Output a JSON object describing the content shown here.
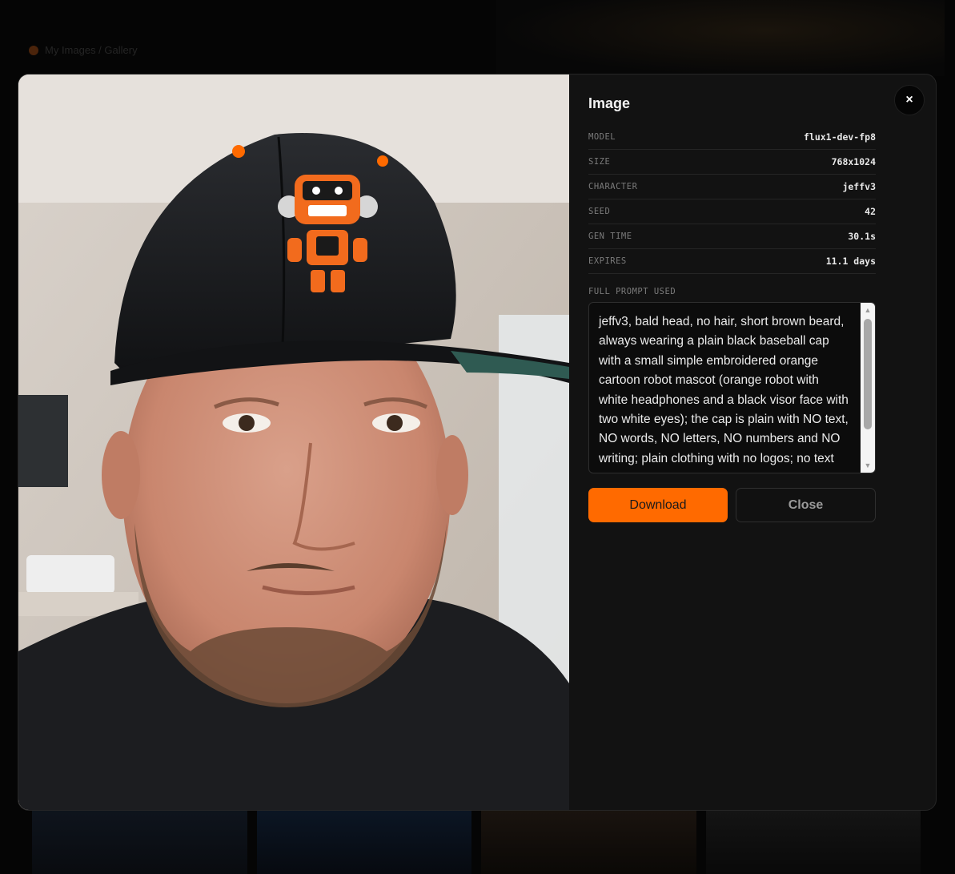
{
  "background": {
    "breadcrumb": "My Images / Gallery"
  },
  "modal": {
    "title": "Image",
    "close_icon": "×",
    "metadata": [
      {
        "key": "MODEL",
        "value": "flux1-dev-fp8"
      },
      {
        "key": "SIZE",
        "value": "768x1024"
      },
      {
        "key": "CHARACTER",
        "value": "jeffv3"
      },
      {
        "key": "SEED",
        "value": "42"
      },
      {
        "key": "GEN TIME",
        "value": "30.1s"
      },
      {
        "key": "EXPIRES",
        "value": "11.1 days"
      }
    ],
    "prompt_label": "FULL PROMPT USED",
    "prompt_text": "jeffv3, bald head, no hair, short brown beard, always wearing a plain black baseball cap with a small simple embroidered orange cartoon robot mascot (orange robot with white headphones and a black visor face with two white eyes); the cap is plain with NO text, NO words, NO letters, NO numbers and NO writing; plain clothing with no logos; no text",
    "buttons": {
      "download": "Download",
      "close": "Close"
    }
  },
  "colors": {
    "accent": "#ff6a00",
    "panel_bg": "#121212",
    "page_bg": "#050505"
  }
}
